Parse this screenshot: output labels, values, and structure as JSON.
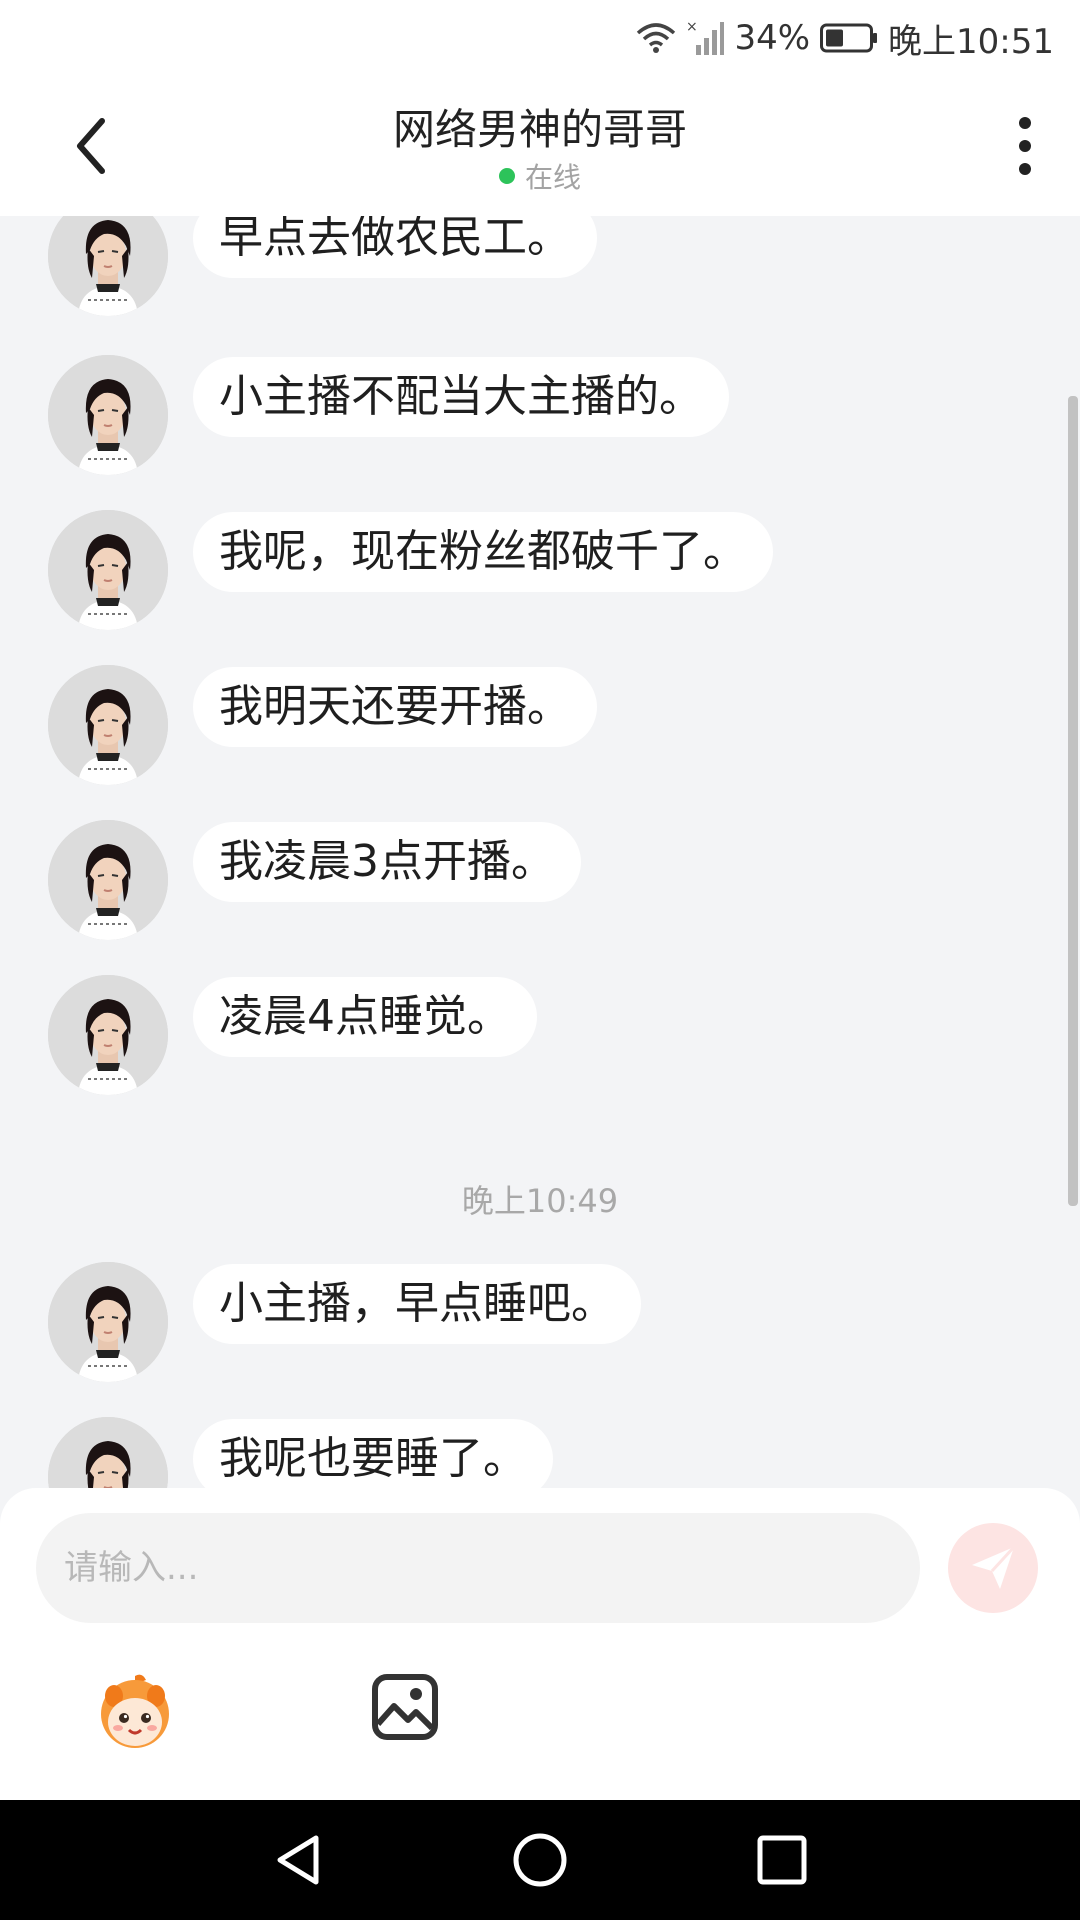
{
  "status_bar": {
    "battery": "34%",
    "time": "晚上10:51",
    "wifi_icon": "wifi-icon",
    "signal_icon": "signal-icon",
    "battery_icon": "battery-icon"
  },
  "header": {
    "title": "网络男神的哥哥",
    "status": "在线",
    "status_color": "#2dc35a",
    "back_icon": "chevron-left-icon",
    "more_icon": "more-vertical-icon"
  },
  "chat": {
    "messages": [
      {
        "text": "早点去做农民工。"
      },
      {
        "text": "小主播不配当大主播的。"
      },
      {
        "text": "我呢，现在粉丝都破千了。"
      },
      {
        "text": "我明天还要开播。"
      },
      {
        "text": "我凌晨3点开播。"
      },
      {
        "text": "凌晨4点睡觉。"
      },
      {
        "text": "小主播，早点睡吧。"
      },
      {
        "text": "我呢也要睡了。"
      }
    ],
    "timestamp": "晚上10:49"
  },
  "composer": {
    "placeholder": "请输入...",
    "send_icon": "send-icon",
    "sticker_icon": "sticker-icon",
    "image_icon": "image-icon",
    "send_color": "#fde4e3"
  },
  "nav_bar": {
    "back_icon": "nav-back-icon",
    "home_icon": "nav-home-icon",
    "recents_icon": "nav-recents-icon"
  }
}
